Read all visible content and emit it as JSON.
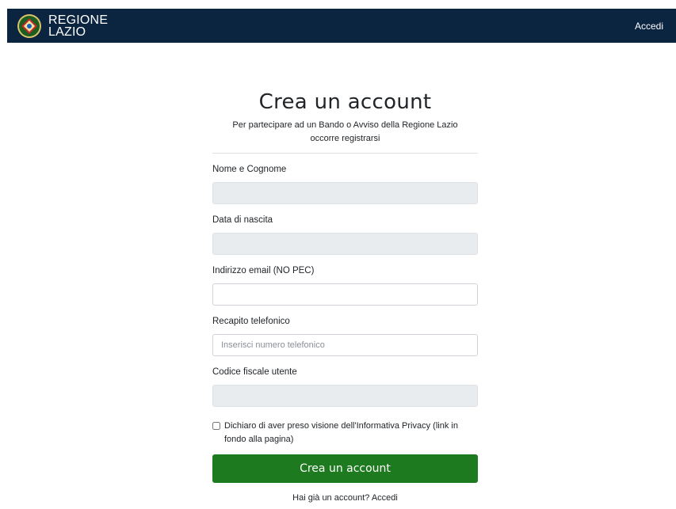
{
  "header": {
    "brand_line1": "REGIONE",
    "brand_line2": "LAZIO",
    "login_link": "Accedi"
  },
  "form": {
    "title": "Crea un account",
    "subtitle": "Per partecipare ad un Bando o Avviso della Regione Lazio occorre registrarsi",
    "fields": [
      {
        "label": "Nome e Cognome",
        "value": "",
        "placeholder": "",
        "readonly": true
      },
      {
        "label": "Data di nascita",
        "value": "",
        "placeholder": "",
        "readonly": true
      },
      {
        "label": "Indirizzo email (NO PEC)",
        "value": "",
        "placeholder": "",
        "readonly": false
      },
      {
        "label": "Recapito telefonico",
        "value": "",
        "placeholder": "Inserisci numero telefonico",
        "readonly": false
      },
      {
        "label": "Codice fiscale utente",
        "value": "",
        "placeholder": "",
        "readonly": true
      }
    ],
    "privacy_text": "Dichiaro di aver preso visione dell'Informativa Privacy (link in fondo alla pagina)",
    "privacy_checked": false,
    "submit_label": "Crea un account",
    "login_prompt": "Hai già un account?",
    "login_link": "Accedi"
  },
  "colors": {
    "navbar": "#0b2440",
    "submit": "#1e7a1e",
    "readonly_field": "#e9ecef"
  }
}
